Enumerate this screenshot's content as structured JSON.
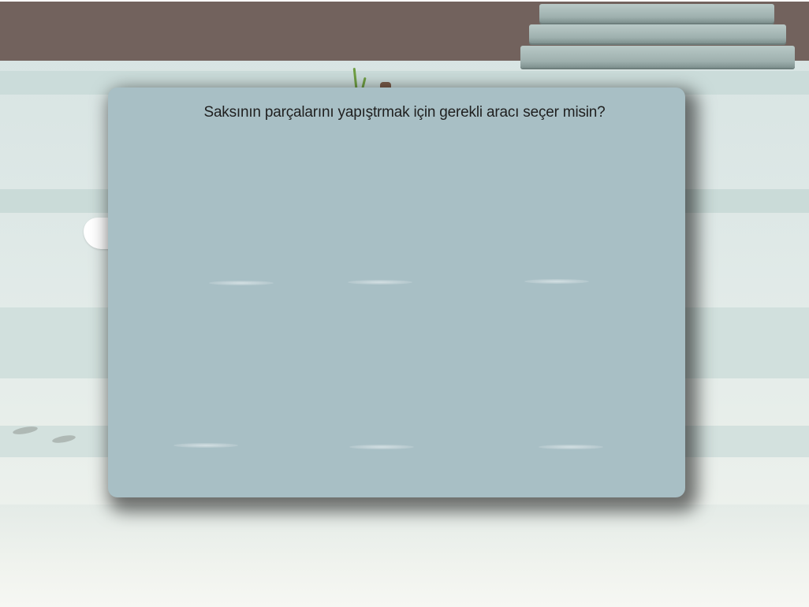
{
  "question": {
    "text": "Saksının parçalarını yapıştrmak için gerekli aracı seçer misin?"
  },
  "options": [
    {
      "slot": 1,
      "label": ""
    },
    {
      "slot": 2,
      "label": ""
    },
    {
      "slot": 3,
      "label": ""
    },
    {
      "slot": 4,
      "label": ""
    },
    {
      "slot": 5,
      "label": ""
    },
    {
      "slot": 6,
      "label": ""
    }
  ],
  "colors": {
    "wall": "#72625d",
    "dialog": "#a8bfc5",
    "stairs": "#9eb0ae",
    "background": "#dfe9e7"
  }
}
